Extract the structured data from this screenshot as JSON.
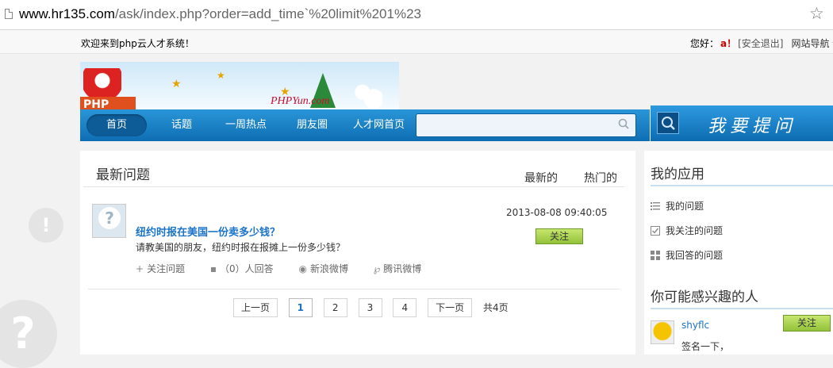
{
  "browser": {
    "url_host": "www.hr135.com",
    "url_path": "/ask/index.php?order=add_time`%20limit%201%23"
  },
  "topbar": {
    "welcome": "欢迎来到php云人才系统！",
    "greeting": "您好：",
    "username": "a！",
    "logout": "[安全退出]",
    "site_nav": "网站导航 ▾"
  },
  "banner": {
    "logo_text": "PHP",
    "brand": "PHPYun.com"
  },
  "nav": {
    "items": [
      "首页",
      "话题",
      "一周热点",
      "朋友圈",
      "人才网首页"
    ]
  },
  "search": {
    "placeholder": ""
  },
  "ask": {
    "label": "我要提问"
  },
  "main": {
    "title": "最新问题",
    "tab_latest": "最新的",
    "tab_hot": "热门的",
    "question": {
      "title": "纽约时报在美国一份卖多少钱？",
      "desc": "请教美国的朋友，纽约时报在报摊上一份多少钱？",
      "time": "2013-08-08 09:40:05",
      "follow": "关注",
      "actions": {
        "follow_q": "关注问题",
        "answers": "（0）人回答",
        "sina": "新浪微博",
        "tencent": "腾讯微博"
      }
    },
    "pager": {
      "prev": "上一页",
      "pages": [
        "1",
        "2",
        "3",
        "4"
      ],
      "current": "1",
      "next": "下一页",
      "total": "共4页"
    }
  },
  "sidebar": {
    "my_apps_title": "我的应用",
    "apps": [
      "我的问题",
      "我关注的问题",
      "我回答的问题"
    ],
    "people_title": "你可能感兴趣的人",
    "person": {
      "name": "shyflc",
      "sign": "签名一下，",
      "follow": "关注"
    }
  }
}
